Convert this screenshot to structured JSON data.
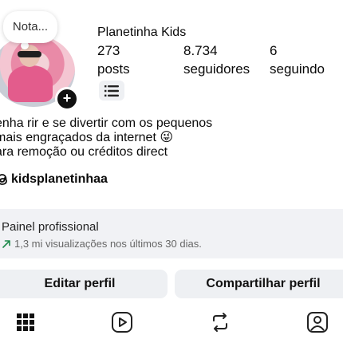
{
  "profile": {
    "name": "Planetinha Kids",
    "note": "Nota...",
    "stats": [
      {
        "value": "273",
        "label": "posts"
      },
      {
        "value": "8.734",
        "label": "seguidores"
      },
      {
        "value": "6",
        "label": "seguindo"
      }
    ],
    "bio_lines": [
      "enha rir e se divertir com os pequenos",
      "mais engraçados da internet 😜",
      "ara remoção ou créditos direct"
    ],
    "threads_handle": "kidsplanetinhaa"
  },
  "professional_panel": {
    "title": "Painel profissional",
    "subtitle": "1,3 mi visualizações nos últimos 30 dias.",
    "trend_icon": "trend-up-arrow-icon",
    "trend_color": "#1f8a4c"
  },
  "actions": {
    "edit_label": "Editar perfil",
    "share_label": "Compartilhar perfil"
  },
  "tabs": [
    {
      "icon": "grid-icon"
    },
    {
      "icon": "reels-icon"
    },
    {
      "icon": "reposts-icon"
    },
    {
      "icon": "tagged-icon"
    }
  ]
}
